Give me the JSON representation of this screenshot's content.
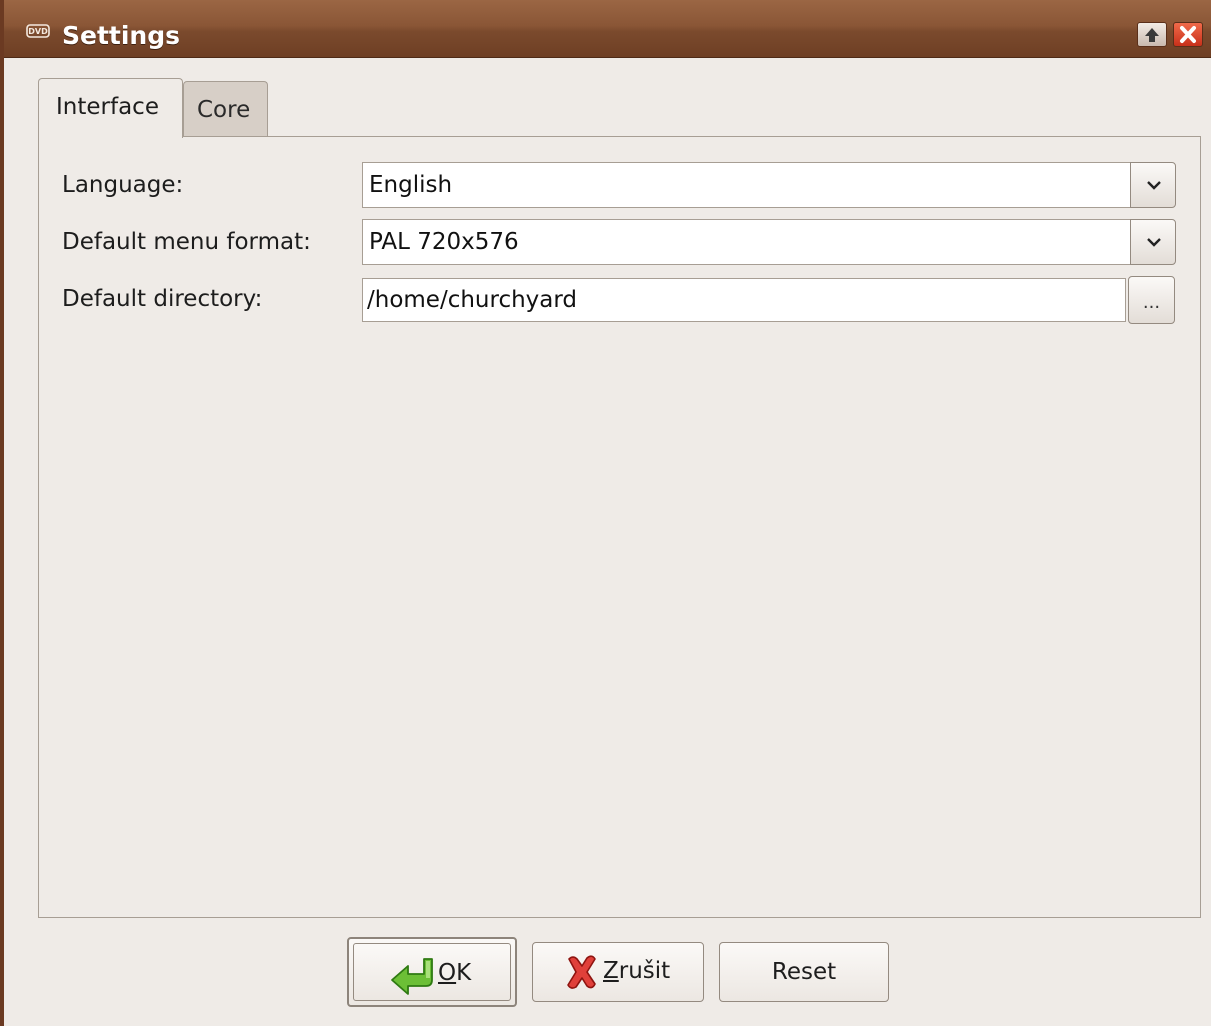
{
  "window": {
    "title": "Settings",
    "icons": {
      "app": "dvd-icon",
      "maximize": "maximize-arrow-icon",
      "close": "close-x-icon"
    }
  },
  "tabs": [
    {
      "label": "Interface",
      "active": true
    },
    {
      "label": "Core",
      "active": false
    }
  ],
  "form": {
    "language": {
      "label": "Language:",
      "value": "English"
    },
    "menu_format": {
      "label": "Default menu format:",
      "value": "PAL 720x576"
    },
    "directory": {
      "label": "Default directory:",
      "value": "/home/churchyard",
      "browse_label": "..."
    }
  },
  "buttons": {
    "ok": {
      "mnemonic": "O",
      "rest": "K",
      "icon": "green-enter-arrow-icon"
    },
    "cancel": {
      "mnemonic": "Z",
      "rest": "rušit",
      "icon": "red-x-icon"
    },
    "reset": {
      "label": "Reset"
    }
  },
  "colors": {
    "titlebar": "#8a5636",
    "background": "#efebe7",
    "inactive_tab": "#d7cfc7",
    "ok_icon": "#5cae2a",
    "cancel_icon": "#d62a2a"
  }
}
